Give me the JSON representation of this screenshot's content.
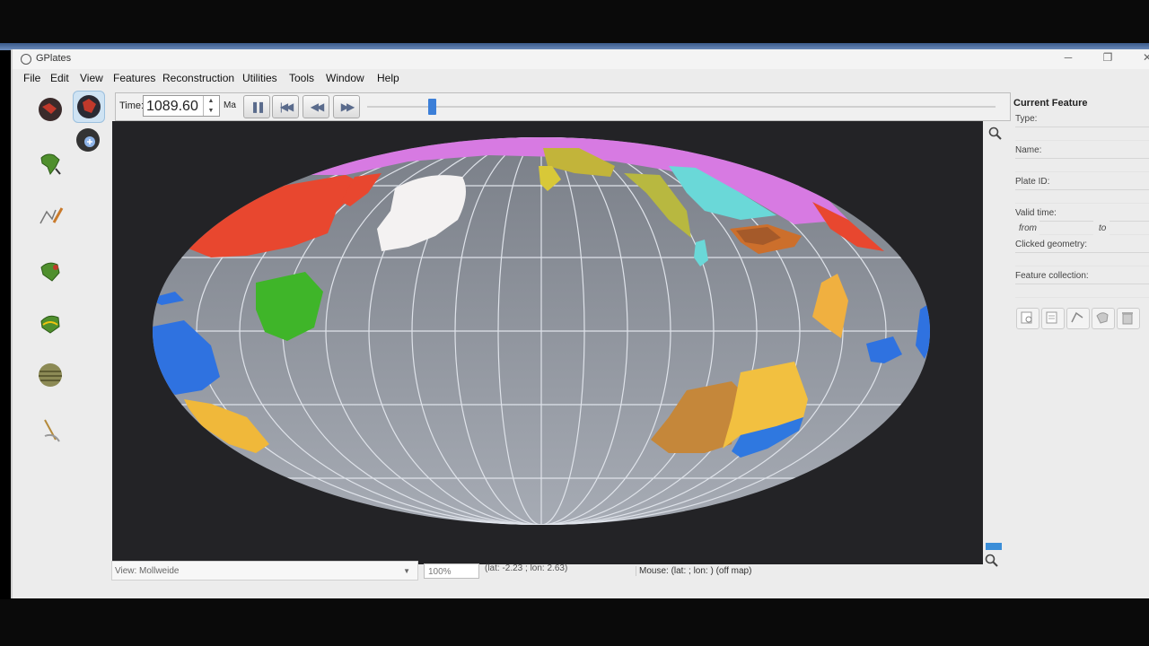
{
  "window": {
    "title": "GPlates"
  },
  "menu": [
    "File",
    "Edit",
    "View",
    "Features",
    "Reconstruction",
    "Utilities",
    "Tools",
    "Window",
    "Help"
  ],
  "toolbar": {
    "time_label": "Time:",
    "time_value": "1089.60",
    "unit": "Ma",
    "buttons": [
      "pause-icon",
      "reset-icon",
      "rewind-icon",
      "fast-forward-icon"
    ],
    "slider_fraction": 0.1
  },
  "statusbar": {
    "view_label": "View:",
    "view_value": "Mollweide",
    "zoom": "100%",
    "coords": "(lat: -2.23 ; lon: 2.63)",
    "mouse": "Mouse: (lat: ; lon: ) (off map)"
  },
  "panel": {
    "title": "Current Feature",
    "type_label": "Type:",
    "name_label": "Name:",
    "plate_id_label": "Plate ID:",
    "valid_time_label": "Valid time:",
    "from_label": "from",
    "to_label": "to",
    "clicked_geometry_label": "Clicked geometry:",
    "feature_collection_label": "Feature collection:"
  },
  "colors": {
    "globe": "#8e939c",
    "background": "#232326",
    "grid": "#dfe3ea",
    "accent": "#3c7fd8"
  }
}
